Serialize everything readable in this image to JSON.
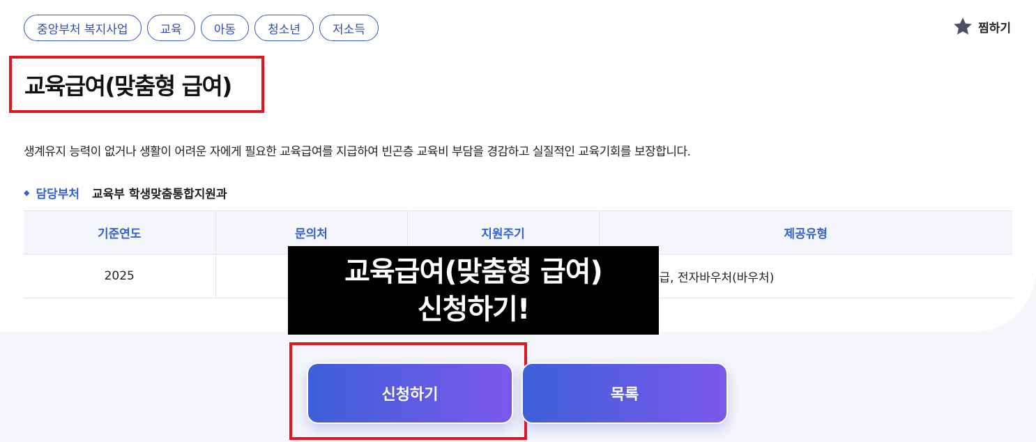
{
  "tags": [
    "중앙부처 복지사업",
    "교육",
    "아동",
    "청소년",
    "저소득"
  ],
  "favorite": {
    "label": "찜하기",
    "icon": "star-icon",
    "color": "#4b5068"
  },
  "title": "교육급여(맞춤형 급여)",
  "description": "생계유지 능력이 없거나 생활이 어려운 자에게 필요한 교육급여를 지급하여 빈곤층 교육비 부담을 경감하고 실질적인 교육기회를 보장합니다.",
  "department": {
    "label": "담당부처",
    "value": "교육부 학생맞춤통합지원과"
  },
  "table": {
    "headers": [
      "기준연도",
      "문의처",
      "지원주기",
      "제공유형"
    ],
    "row": [
      "2025",
      "",
      "",
      "급, 전자바우처(바우처)"
    ]
  },
  "overlay": {
    "line1": "교육급여(맞춤형 급여)",
    "line2": "신청하기!"
  },
  "buttons": {
    "apply": "신청하기",
    "list": "목록"
  },
  "colors": {
    "accent": "#3561d0",
    "highlight": "#e3151f",
    "button_start": "#3d5fd8",
    "button_end": "#7b58ec"
  }
}
